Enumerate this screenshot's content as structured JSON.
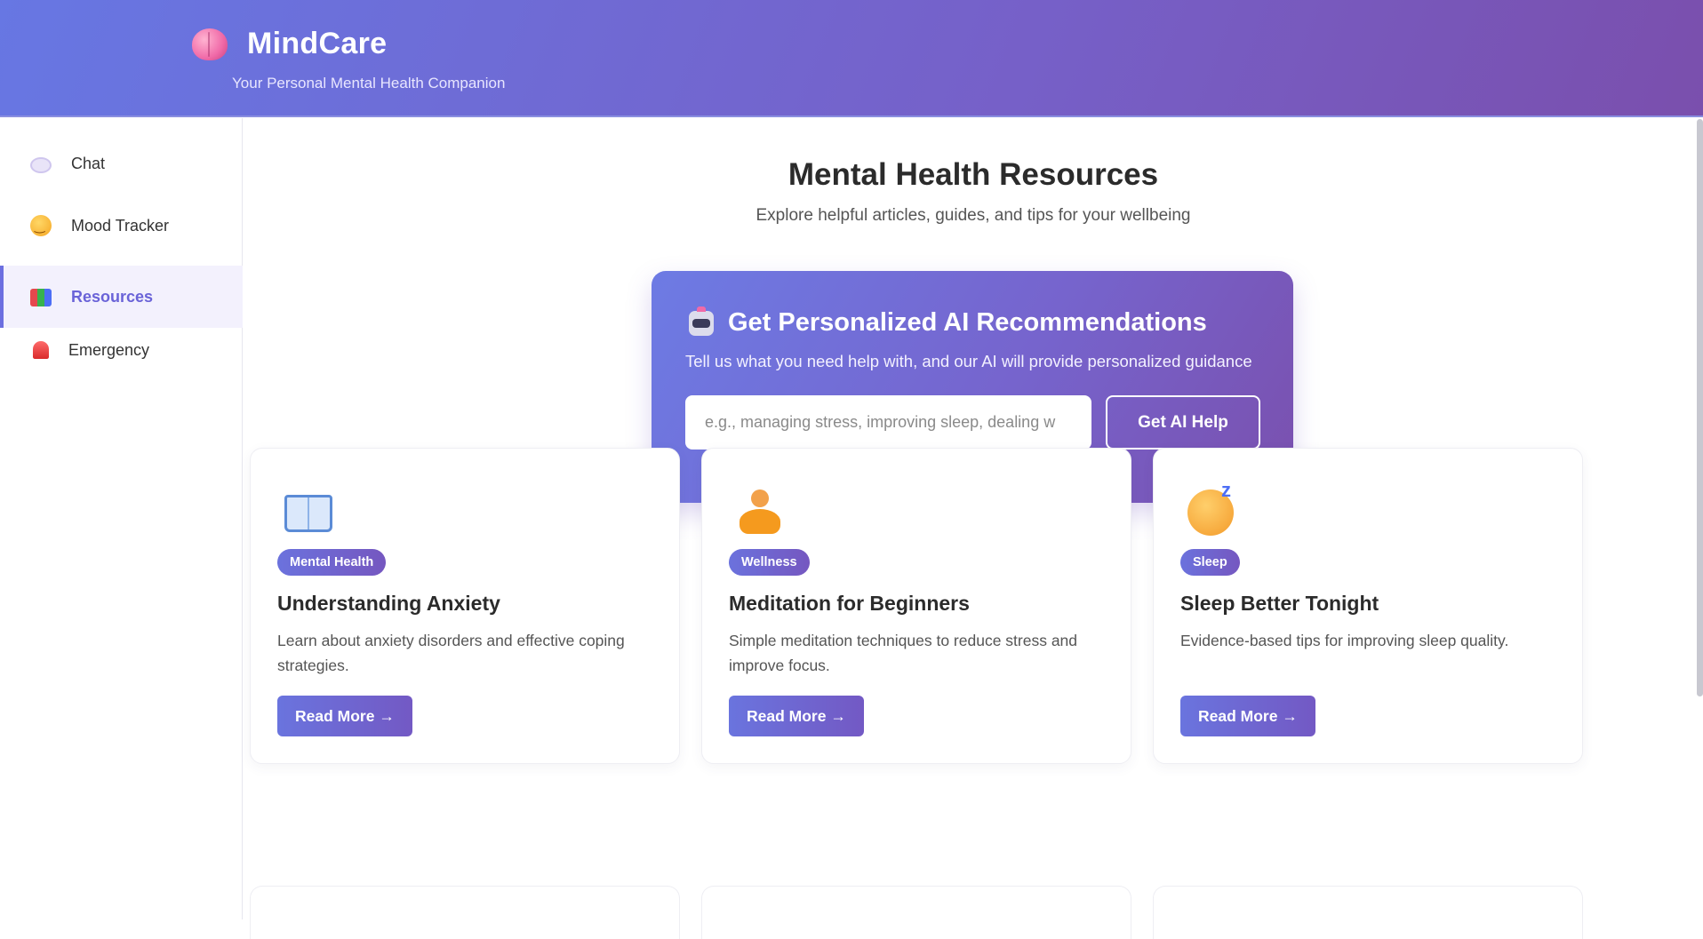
{
  "header": {
    "title": "MindCare",
    "subtitle": "Your Personal Mental Health Companion",
    "logo_icon": "brain-icon"
  },
  "sidebar": {
    "items": [
      {
        "label": "Chat",
        "icon": "speech-bubble-icon",
        "active": false
      },
      {
        "label": "Mood Tracker",
        "icon": "smile-icon",
        "active": false
      },
      {
        "label": "Resources",
        "icon": "books-icon",
        "active": true
      },
      {
        "label": "Emergency",
        "icon": "siren-icon",
        "active": false
      }
    ]
  },
  "main": {
    "title": "Mental Health Resources",
    "subtitle": "Explore helpful articles, guides, and tips for your wellbeing",
    "ai_box": {
      "icon": "robot-icon",
      "title": "Get Personalized AI Recommendations",
      "description": "Tell us what you need help with, and our AI will provide personalized guidance",
      "input_placeholder": "e.g., managing stress, improving sleep, dealing w",
      "input_value": "",
      "button_label": "Get AI Help"
    },
    "cards": [
      {
        "icon": "open-book-icon",
        "tag": "Mental Health",
        "title": "Understanding Anxiety",
        "description": "Learn about anxiety disorders and effective coping strategies.",
        "button_label": "Read More →"
      },
      {
        "icon": "meditation-icon",
        "tag": "Wellness",
        "title": "Meditation for Beginners",
        "description": "Simple meditation techniques to reduce stress and improve focus.",
        "button_label": "Read More →"
      },
      {
        "icon": "sleeping-face-icon",
        "tag": "Sleep",
        "title": "Sleep Better Tonight",
        "description": "Evidence-based tips for improving sleep quality.",
        "button_label": "Read More →"
      }
    ]
  },
  "colors": {
    "accent": "#6a63d8",
    "header_gradient_start": "#6777e3",
    "header_gradient_end": "#7a4fad"
  }
}
